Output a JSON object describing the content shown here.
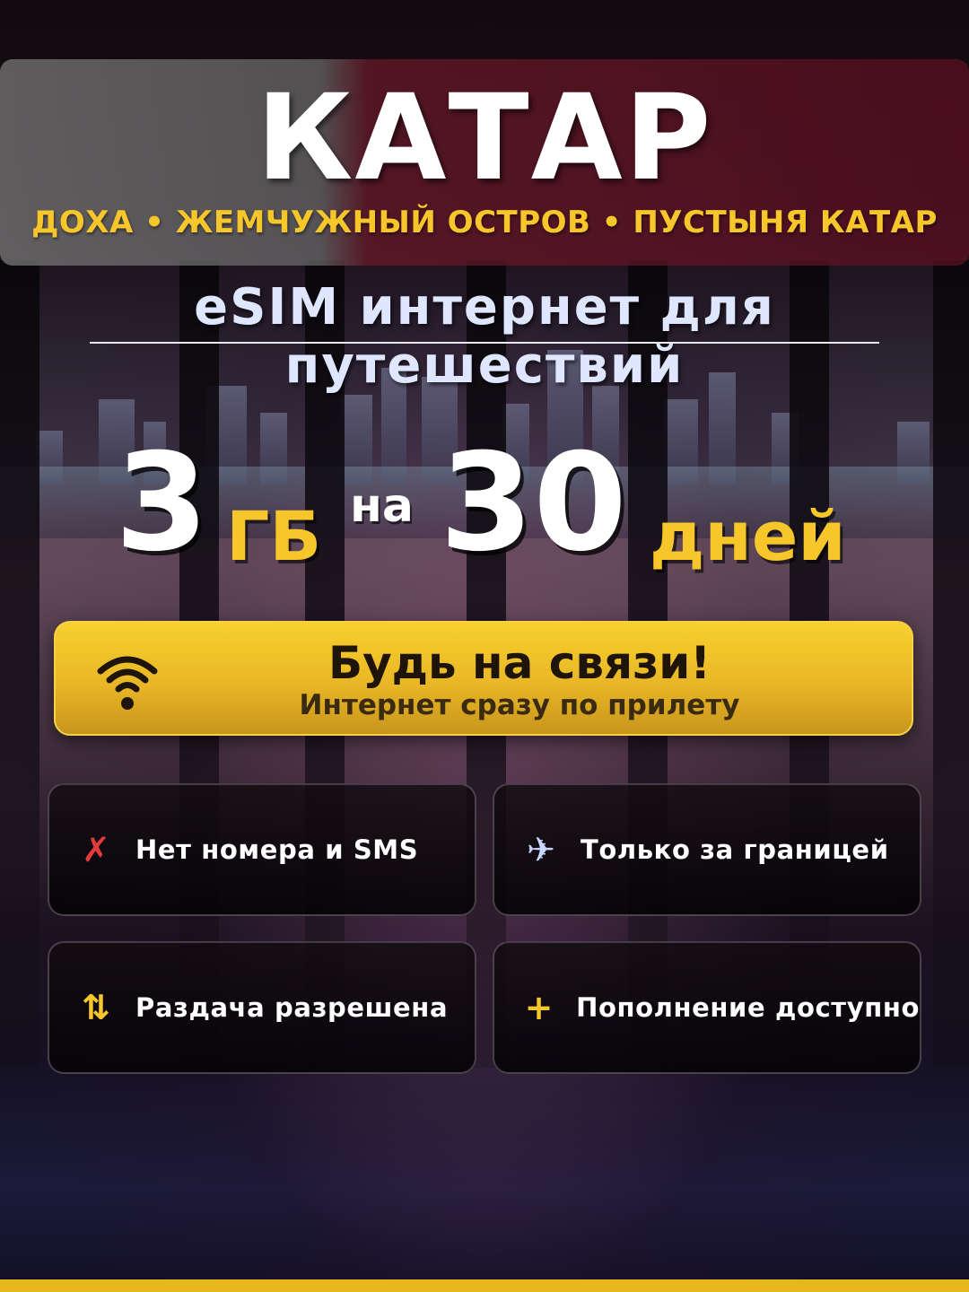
{
  "header": {
    "title": "КАТАР",
    "subtitle": "ДОХА • ЖЕМЧУЖНЫЙ ОСТРОВ • ПУСТЫНЯ КАТАР"
  },
  "tagline": "eSIM интернет для путешествий",
  "offer": {
    "data_amount": "3",
    "data_unit": "ГБ",
    "connector": "на",
    "days_amount": "30",
    "days_unit": "дней"
  },
  "cta": {
    "icon": "wifi-icon",
    "title": "Будь на связи!",
    "subtitle": "Интернет сразу по прилету"
  },
  "features": [
    {
      "icon": "cross-icon",
      "icon_color": "#e23b3b",
      "label": "Нет номера и SMS"
    },
    {
      "icon": "airplane-icon",
      "icon_color": "#c9d6ff",
      "label": "Только за границей"
    },
    {
      "icon": "up-down-arrows-icon",
      "icon_color": "#f6c62a",
      "label": "Раздача разрешена"
    },
    {
      "icon": "plus-icon",
      "icon_color": "#f6c62a",
      "label": "Пополнение доступно"
    }
  ],
  "colors": {
    "accent_yellow": "#f6c62a",
    "flag_maroon": "#8a1538",
    "tagline_blue": "#dfe6ff"
  }
}
